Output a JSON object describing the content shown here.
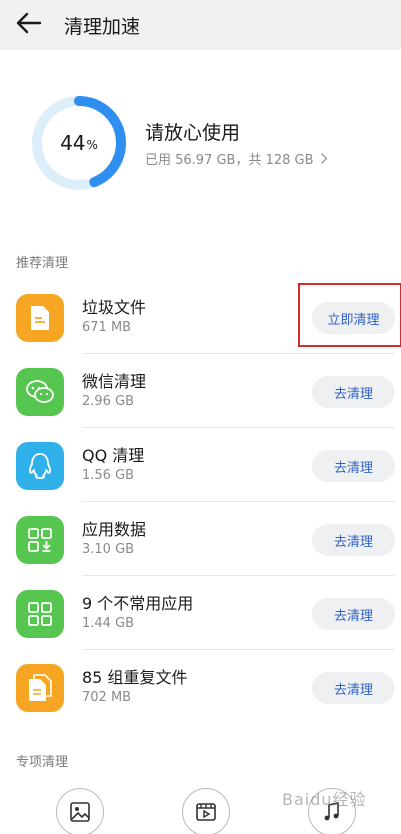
{
  "header": {
    "title": "清理加速"
  },
  "overview": {
    "percent": "44",
    "percent_unit": "%",
    "usage_fraction": 0.44,
    "status": "请放心使用",
    "storage_text": "已用 56.97 GB，共 128 GB"
  },
  "sections": {
    "recommended": "推荐清理",
    "special": "专项清理"
  },
  "items": [
    {
      "name": "垃圾文件",
      "size": "671 MB",
      "button": "立即清理",
      "icon": "file-icon",
      "color": "#f6a623"
    },
    {
      "name": "微信清理",
      "size": "2.96 GB",
      "button": "去清理",
      "icon": "wechat-icon",
      "color": "#57c650"
    },
    {
      "name": "QQ 清理",
      "size": "1.56 GB",
      "button": "去清理",
      "icon": "qq-icon",
      "color": "#2fb0e8"
    },
    {
      "name": "应用数据",
      "size": "3.10 GB",
      "button": "去清理",
      "icon": "app-data-icon",
      "color": "#57c650"
    },
    {
      "name": "9 个不常用应用",
      "size": "1.44 GB",
      "button": "去清理",
      "icon": "apps-grid-icon",
      "color": "#57c650"
    },
    {
      "name": "85 组重复文件",
      "size": "702 MB",
      "button": "去清理",
      "icon": "duplicate-file-icon",
      "color": "#f6a623"
    }
  ],
  "watermark": "Baidu经验",
  "colors": {
    "ring_track": "#ddeefb",
    "ring_fill": "#2e8ff0",
    "button_text": "#2f62c8",
    "highlight": "#d42a2a"
  }
}
